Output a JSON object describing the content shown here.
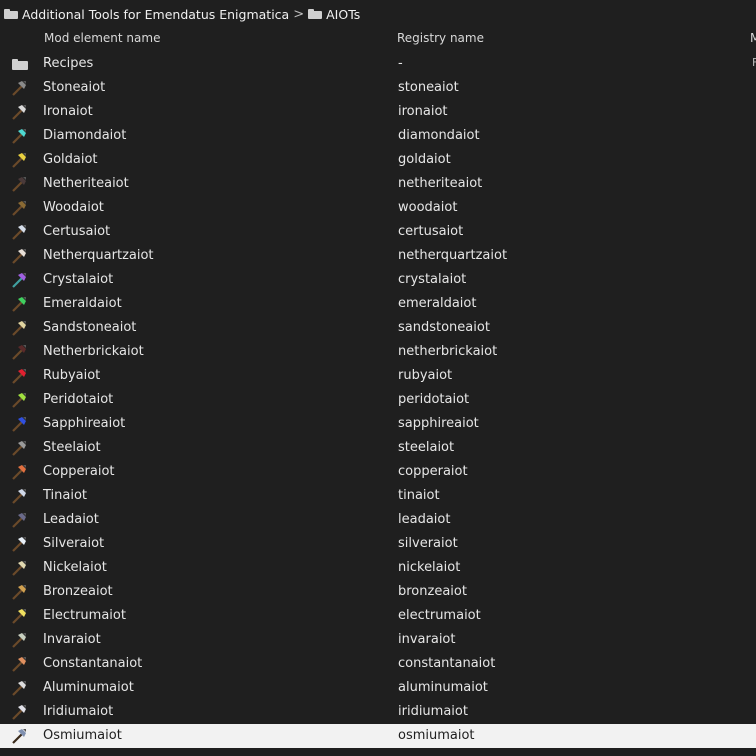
{
  "breadcrumb": {
    "items": [
      "Additional Tools for Emendatus Enigmatica",
      "AIOTs"
    ],
    "separator": ">"
  },
  "columns": {
    "name": "Mod element name",
    "registry": "Registry name",
    "third": "M"
  },
  "rows": [
    {
      "name": "Recipes",
      "registry": "-",
      "type": "folder",
      "third": "F"
    },
    {
      "name": "Stoneaiot",
      "registry": "stoneaiot",
      "type": "tool",
      "head": "#8a8a8a",
      "handle": "#6b4a2a"
    },
    {
      "name": "Ironaiot",
      "registry": "ironaiot",
      "type": "tool",
      "head": "#d8d8d8",
      "handle": "#6b4a2a"
    },
    {
      "name": "Diamondaiot",
      "registry": "diamondaiot",
      "type": "tool",
      "head": "#4fd8d0",
      "handle": "#6b4a2a"
    },
    {
      "name": "Goldaiot",
      "registry": "goldaiot",
      "type": "tool",
      "head": "#e8d040",
      "handle": "#6b4a2a"
    },
    {
      "name": "Netheriteaiot",
      "registry": "netheriteaiot",
      "type": "tool",
      "head": "#4a3a3a",
      "handle": "#6b4a2a"
    },
    {
      "name": "Woodaiot",
      "registry": "woodaiot",
      "type": "tool",
      "head": "#8a6a34",
      "handle": "#6b4a2a"
    },
    {
      "name": "Certusaiot",
      "registry": "certusaiot",
      "type": "tool",
      "head": "#d4dce8",
      "handle": "#6b4a2a"
    },
    {
      "name": "Netherquartzaiot",
      "registry": "netherquartzaiot",
      "type": "tool",
      "head": "#e8e0d8",
      "handle": "#6b4a2a"
    },
    {
      "name": "Crystalaiot",
      "registry": "crystalaiot",
      "type": "tool",
      "head": "#a060e0",
      "handle": "#40a0a0"
    },
    {
      "name": "Emeraldaiot",
      "registry": "emeraldaiot",
      "type": "tool",
      "head": "#40d060",
      "handle": "#6b4a2a"
    },
    {
      "name": "Sandstoneaiot",
      "registry": "sandstoneaiot",
      "type": "tool",
      "head": "#e0d4a0",
      "handle": "#6b4a2a"
    },
    {
      "name": "Netherbrickaiot",
      "registry": "netherbrickaiot",
      "type": "tool",
      "head": "#5a2a2a",
      "handle": "#6b4a2a"
    },
    {
      "name": "Rubyaiot",
      "registry": "rubyaiot",
      "type": "tool",
      "head": "#e02030",
      "handle": "#6b4a2a"
    },
    {
      "name": "Peridotaiot",
      "registry": "peridotaiot",
      "type": "tool",
      "head": "#a0e040",
      "handle": "#6b4a2a"
    },
    {
      "name": "Sapphireaiot",
      "registry": "sapphireaiot",
      "type": "tool",
      "head": "#3050e0",
      "handle": "#6b4a2a"
    },
    {
      "name": "Steelaiot",
      "registry": "steelaiot",
      "type": "tool",
      "head": "#9a9a9a",
      "handle": "#6b4a2a"
    },
    {
      "name": "Copperaiot",
      "registry": "copperaiot",
      "type": "tool",
      "head": "#e07040",
      "handle": "#6b4a2a"
    },
    {
      "name": "Tinaiot",
      "registry": "tinaiot",
      "type": "tool",
      "head": "#d0d8e8",
      "handle": "#6b4a2a"
    },
    {
      "name": "Leadaiot",
      "registry": "leadaiot",
      "type": "tool",
      "head": "#6a6a8a",
      "handle": "#6b4a2a"
    },
    {
      "name": "Silveraiot",
      "registry": "silveraiot",
      "type": "tool",
      "head": "#e8f0f8",
      "handle": "#6b4a2a"
    },
    {
      "name": "Nickelaiot",
      "registry": "nickelaiot",
      "type": "tool",
      "head": "#e0d8b0",
      "handle": "#6b4a2a"
    },
    {
      "name": "Bronzeaiot",
      "registry": "bronzeaiot",
      "type": "tool",
      "head": "#d0a050",
      "handle": "#6b4a2a"
    },
    {
      "name": "Electrumaiot",
      "registry": "electrumaiot",
      "type": "tool",
      "head": "#f0e060",
      "handle": "#6b4a2a"
    },
    {
      "name": "Invaraiot",
      "registry": "invaraiot",
      "type": "tool",
      "head": "#c8d0c0",
      "handle": "#6b4a2a"
    },
    {
      "name": "Constantanaiot",
      "registry": "constantanaiot",
      "type": "tool",
      "head": "#e09060",
      "handle": "#6b4a2a"
    },
    {
      "name": "Aluminumaiot",
      "registry": "aluminumaiot",
      "type": "tool",
      "head": "#dcdcdc",
      "handle": "#6b4a2a"
    },
    {
      "name": "Iridiumaiot",
      "registry": "iridiumaiot",
      "type": "tool",
      "head": "#e0e0e8",
      "handle": "#6b4a2a"
    },
    {
      "name": "Osmiumaiot",
      "registry": "osmiumaiot",
      "type": "tool",
      "head": "#8090b0",
      "handle": "#3a2a1a",
      "selected": true
    }
  ]
}
